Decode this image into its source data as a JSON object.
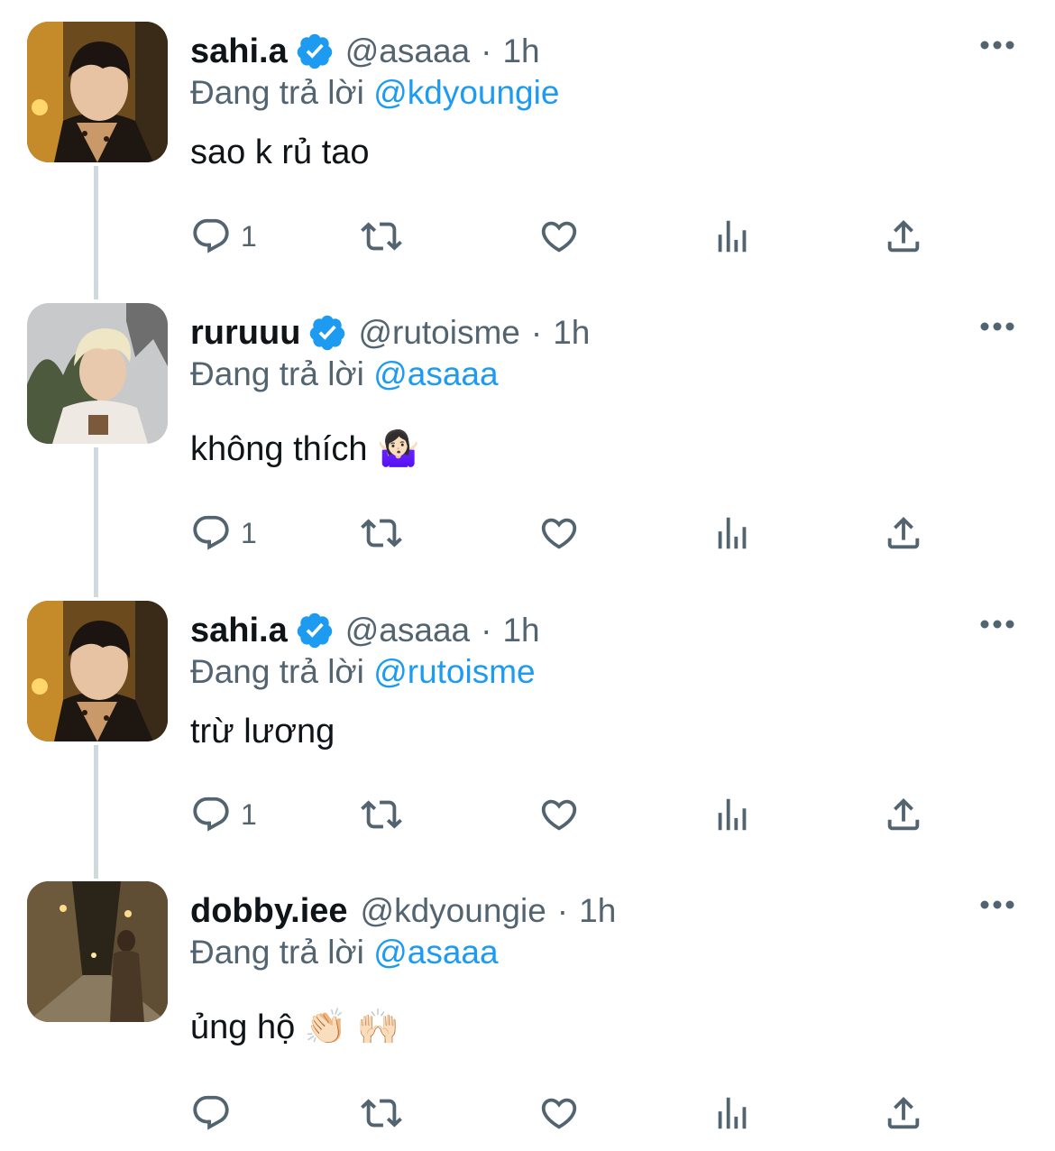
{
  "tweets": [
    {
      "name": "sahi.a",
      "verified": true,
      "handle": "@asaaa",
      "time": "1h",
      "reply_prefix": "Đang trả lời",
      "reply_to": "@kdyoungie",
      "text": "sao k rủ tao",
      "reply_count": "1",
      "avatar": "portrait-boy-leopard-shirt"
    },
    {
      "name": "ruruuu",
      "verified": true,
      "handle": "@rutoisme",
      "time": "1h",
      "reply_prefix": "Đang trả lời",
      "reply_to": "@asaaa",
      "text": "không thích 🤷🏻‍♀️",
      "reply_count": "1",
      "avatar": "portrait-blonde-white-shirt"
    },
    {
      "name": "sahi.a",
      "verified": true,
      "handle": "@asaaa",
      "time": "1h",
      "reply_prefix": "Đang trả lời",
      "reply_to": "@rutoisme",
      "text": "trừ lương",
      "reply_count": "1",
      "avatar": "portrait-boy-leopard-shirt"
    },
    {
      "name": "dobby.iee",
      "verified": false,
      "handle": "@kdyoungie",
      "time": "1h",
      "reply_prefix": "Đang trả lời",
      "reply_to": "@asaaa",
      "text": "ủng hộ 👏🏻 🙌🏻",
      "reply_count": "",
      "avatar": "night-street-walker"
    }
  ],
  "separator": "·",
  "icons": {
    "reply": "reply-icon",
    "retweet": "retweet-icon",
    "like": "heart-icon",
    "views": "analytics-icon",
    "share": "share-icon",
    "more": "more-icon",
    "verified": "verified-badge-icon"
  },
  "colors": {
    "accent": "#1d9bf0",
    "secondary_text": "#536471",
    "thread_line": "#cfd9de"
  }
}
